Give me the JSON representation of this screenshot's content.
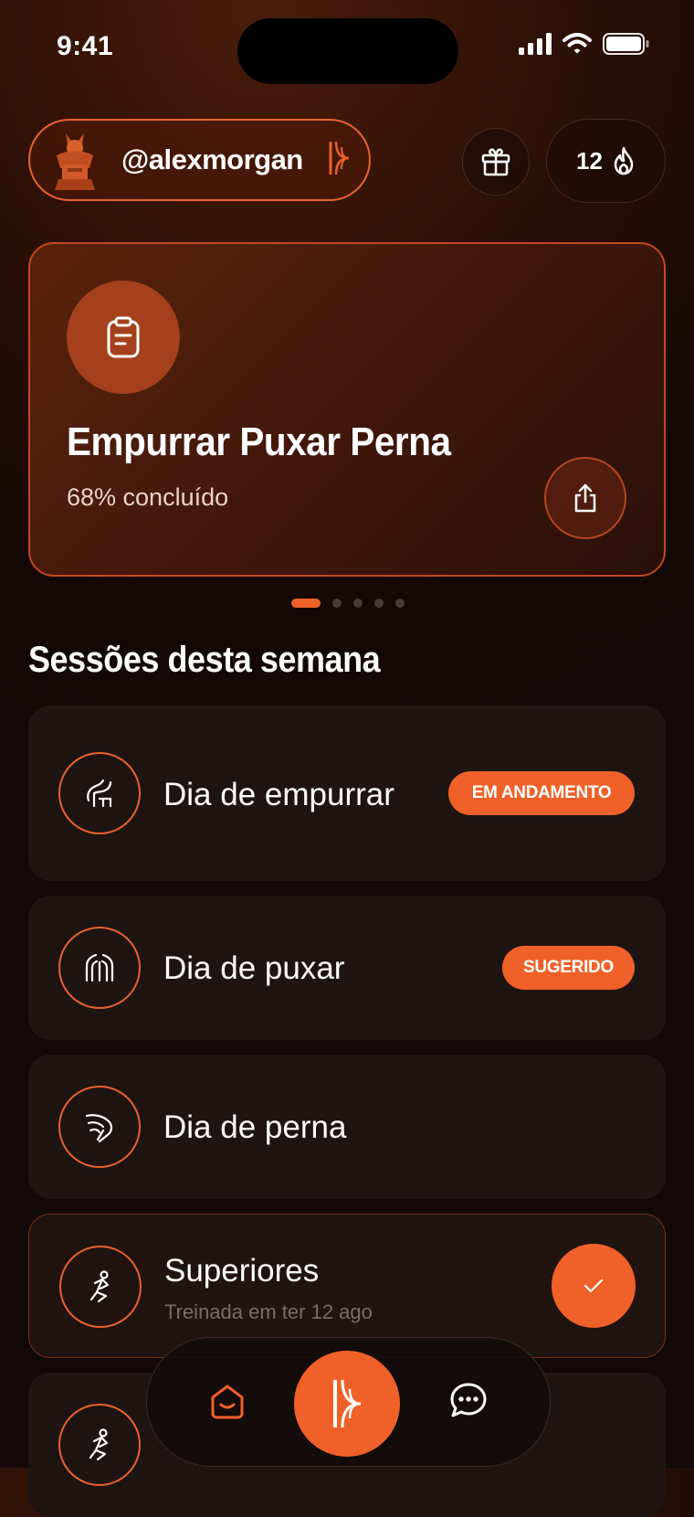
{
  "status_bar": {
    "time": "9:41"
  },
  "header": {
    "username": "@alexmorgan",
    "streak_count": "12",
    "icons": {
      "gift": "gift-icon",
      "streak": "flame-icon",
      "brand": "brand-k-icon"
    }
  },
  "hero": {
    "title": "Empurrar Puxar Perna",
    "progress_text": "68% concluído",
    "progress_fraction": 0.68,
    "icons": {
      "main": "clipboard-icon",
      "share": "share-icon"
    }
  },
  "pagination": {
    "count": 5,
    "active_index": 0
  },
  "sessions_title": "Sessões desta semana",
  "sessions": [
    {
      "label": "Dia de empurrar",
      "badge": "EM ANDAMENTO",
      "icon": "chest-icon"
    },
    {
      "label": "Dia de puxar",
      "badge": "SUGERIDO",
      "icon": "back-icon"
    },
    {
      "label": "Dia de perna",
      "icon": "leg-icon"
    },
    {
      "label": "Superiores",
      "subtitle": "Treinada em ter 12 ago",
      "completed": true,
      "icon": "upper-body-icon"
    },
    {
      "label": "",
      "icon": "upper-body-icon"
    }
  ],
  "nav": {
    "items": [
      "home-icon",
      "brand-k-icon",
      "chat-icon"
    ]
  },
  "colors": {
    "accent": "#f06129",
    "card_bg": "#1e1412",
    "hero_border": "#c4471c"
  }
}
